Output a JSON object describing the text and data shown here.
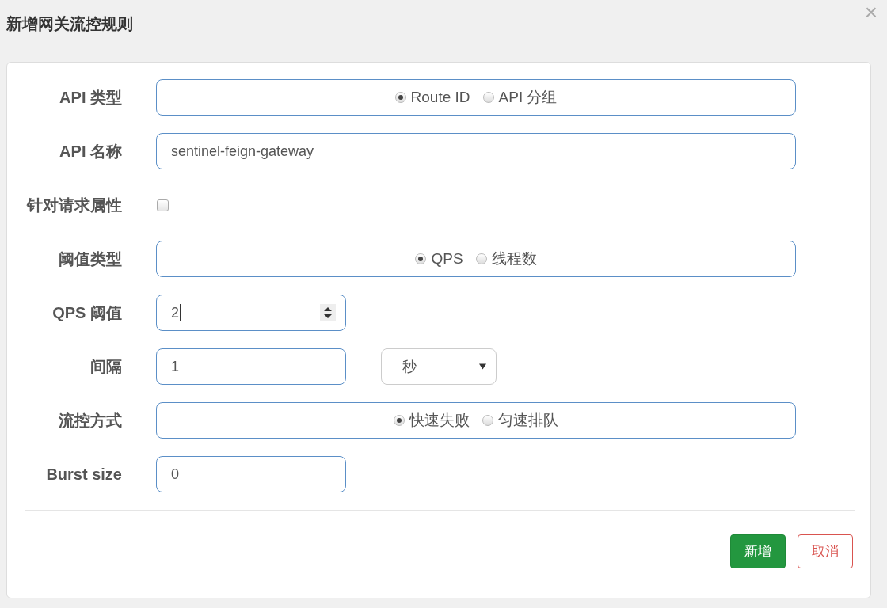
{
  "dialog": {
    "title": "新增网关流控规则",
    "close": "×"
  },
  "fields": [
    {
      "kind": "radio",
      "label": "API 类型",
      "options": [
        {
          "label": "Route ID",
          "selected": true
        },
        {
          "label": "API 分组",
          "selected": false
        }
      ]
    },
    {
      "kind": "text",
      "label": "API 名称",
      "value": "sentinel-feign-gateway"
    },
    {
      "kind": "checkbox",
      "label": "针对请求属性",
      "checked": false
    },
    {
      "kind": "radio",
      "label": "阈值类型",
      "options": [
        {
          "label": "QPS",
          "selected": true
        },
        {
          "label": "线程数",
          "selected": false
        }
      ]
    },
    {
      "kind": "number",
      "label": "QPS 阈值",
      "value": "2"
    },
    {
      "kind": "text_select",
      "label": "间隔",
      "value": "1",
      "select": "秒"
    },
    {
      "kind": "radio",
      "label": "流控方式",
      "options": [
        {
          "label": "快速失败",
          "selected": true
        },
        {
          "label": "匀速排队",
          "selected": false
        }
      ]
    },
    {
      "kind": "short_text",
      "label": "Burst size",
      "value": "0"
    }
  ],
  "buttons": [
    {
      "label": "新增",
      "kind": "primary"
    },
    {
      "label": "取消",
      "kind": "danger"
    }
  ]
}
